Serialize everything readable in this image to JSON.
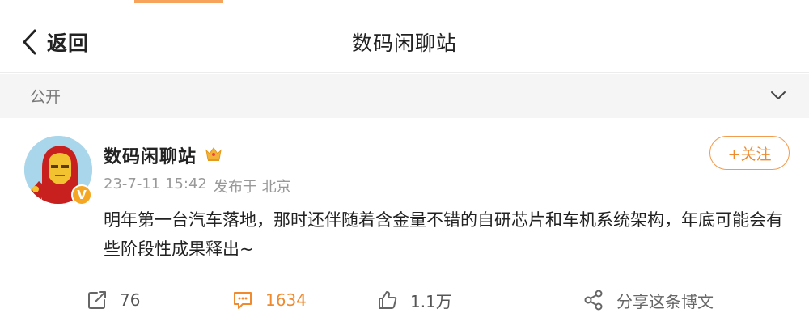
{
  "header": {
    "back_label": "返回",
    "title": "数码闲聊站"
  },
  "visibility": {
    "label": "公开"
  },
  "post": {
    "username": "数码闲聊站",
    "timestamp": "23-7-11 15:42",
    "published_from": "发布于 北京",
    "follow_label": "+关注",
    "content": "明年第一台汽车落地，那时还伴随着含金量不错的自研芯片和车机系统架构，年底可能会有些阶段性成果释出~",
    "verified_badge": "V"
  },
  "actions": {
    "repost_count": "76",
    "comment_count": "1634",
    "like_count": "1.1万",
    "share_label": "分享这条博文"
  },
  "colors": {
    "accent": "#ef8a2e",
    "badge": "#f5a623",
    "divider_bg": "#f5f5f5"
  },
  "icons": {
    "back": "chevron-left-icon",
    "visibility": "chevron-down-icon",
    "crown": "crown-icon",
    "repost": "repost-icon",
    "comment": "comment-icon",
    "like": "thumbs-up-icon",
    "share": "share-icon"
  }
}
